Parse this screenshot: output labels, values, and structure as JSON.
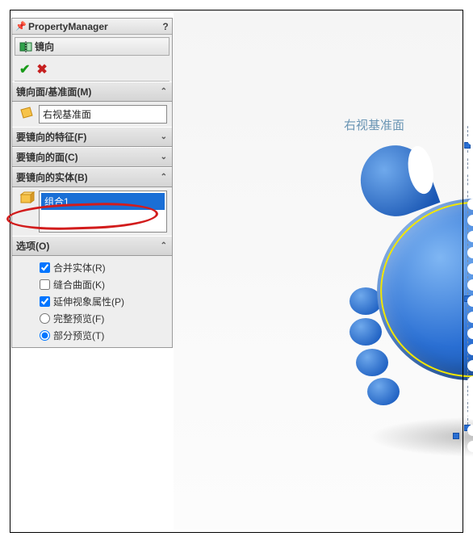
{
  "panel": {
    "title": "PropertyManager",
    "feature_name": "镜向"
  },
  "sections": {
    "mirror_face": {
      "title": "镜向面/基准面(M)",
      "value": "右视基准面"
    },
    "features": {
      "title": "要镜向的特征(F)"
    },
    "faces": {
      "title": "要镜向的面(C)"
    },
    "bodies": {
      "title": "要镜向的实体(B)",
      "selected": "组合1"
    },
    "options": {
      "title": "选项(O)",
      "merge_solids": {
        "label": "合并实体(R)",
        "checked": true
      },
      "knit_surfaces": {
        "label": "缝合曲面(K)",
        "checked": false
      },
      "propagate_visual": {
        "label": "延伸视象属性(P)",
        "checked": true
      },
      "full_preview": {
        "label": "完整预览(F)",
        "selected": false
      },
      "partial_preview": {
        "label": "部分预览(T)",
        "selected": true
      }
    }
  },
  "viewport": {
    "plane_label": "右视基准面"
  }
}
